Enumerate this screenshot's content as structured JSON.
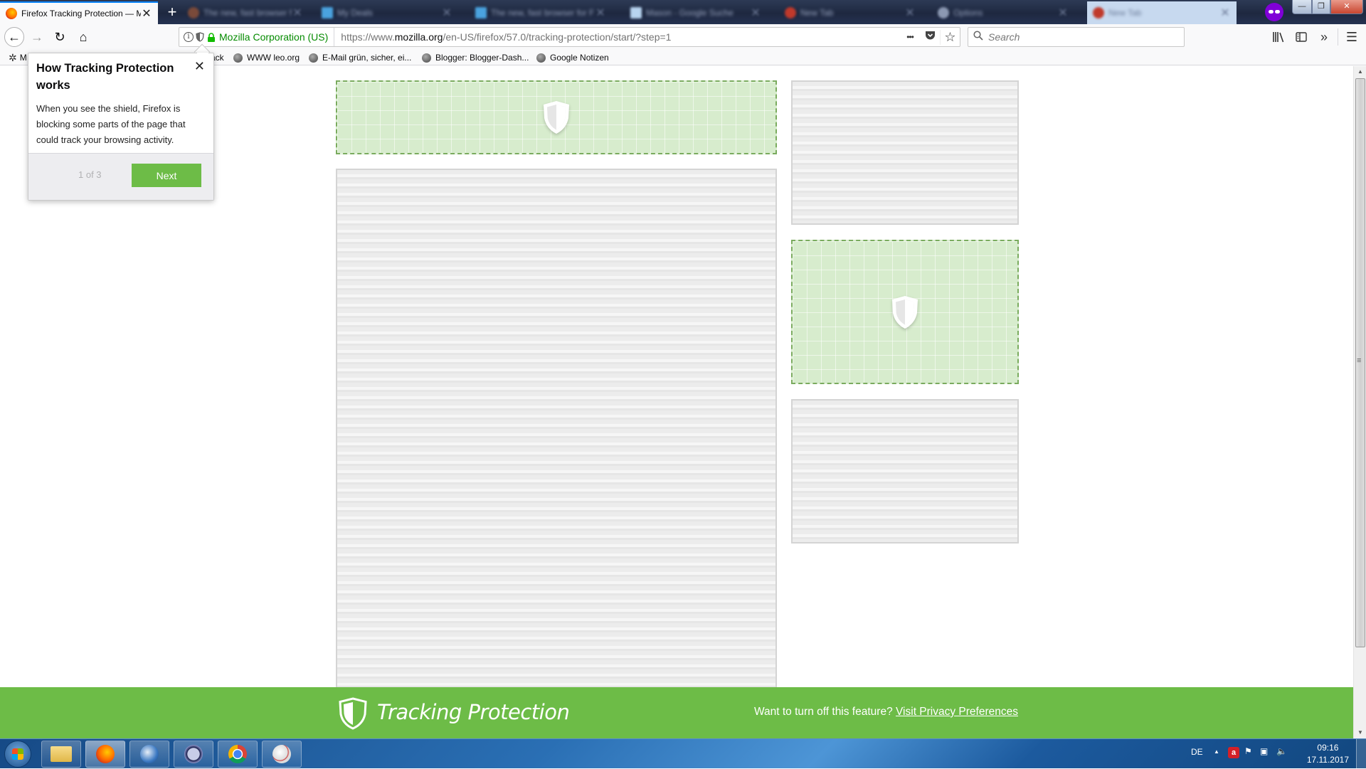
{
  "browser": {
    "active_tab": {
      "title": "Firefox Tracking Protection — Mozilla",
      "close": "✕"
    },
    "background_tabs": [
      {
        "title": "The new, fast browser for Fi...",
        "close": "✕",
        "favicon_color": "#7a4a3a"
      },
      {
        "title": "My Deals",
        "close": "✕",
        "favicon_color": "#4aa3df"
      },
      {
        "title": "The new, fast browser for Fi...",
        "close": "✕",
        "favicon_color": "#4aa3df"
      },
      {
        "title": "Mason - Google Suche",
        "close": "✕",
        "favicon_color": "#b8d4f0"
      },
      {
        "title": "New Tab",
        "close": "✕",
        "favicon_color": "#c0392b"
      },
      {
        "title": "Options",
        "close": "✕",
        "favicon_color": "#8c99b3"
      },
      {
        "title": "New Tab",
        "close": "✕",
        "favicon_color": "#c0392b"
      }
    ],
    "new_tab": "+",
    "window_controls": {
      "minimize": "—",
      "maximize": "❐",
      "close": "✕"
    }
  },
  "toolbar": {
    "back": "←",
    "forward": "→",
    "reload": "↻",
    "home": "⌂",
    "identity_info": "i",
    "identity_org": "Mozilla Corporation (US)",
    "url_prefix": "https://www.",
    "url_domain": "mozilla.org",
    "url_path": "/en-US/firefox/57.0/tracking-protection/start/?step=1",
    "page_actions": "•••",
    "pocket": "⛉",
    "bookmark_star": "☆",
    "search_placeholder": "Search",
    "library": "|||\\",
    "sidebar": "◫",
    "overflow": "»",
    "menu": "☰"
  },
  "bookmarks": [
    {
      "label": "M",
      "icon": "gear"
    },
    {
      "label": "ack",
      "icon": "none"
    },
    {
      "label": "WWW leo.org",
      "icon": "globe"
    },
    {
      "label": "E-Mail grün, sicher, ei...",
      "icon": "globe"
    },
    {
      "label": "Blogger: Blogger-Dash...",
      "icon": "globe"
    },
    {
      "label": "Google Notizen",
      "icon": "globe"
    }
  ],
  "popup": {
    "title": "How Tracking Protection works",
    "close": "✕",
    "body": "When you see the shield, Firefox is blocking some parts of the page that could track your browsing activity.",
    "step": "1 of 3",
    "next_label": "Next"
  },
  "page": {
    "blocks": [
      {
        "kind": "blocked",
        "label": "blocked-tracker-banner"
      },
      {
        "kind": "placeholder",
        "label": "content-main"
      },
      {
        "kind": "placeholder",
        "label": "content-side-top"
      },
      {
        "kind": "blocked",
        "label": "blocked-tracker-side"
      },
      {
        "kind": "placeholder",
        "label": "content-side-bottom"
      }
    ],
    "footer": {
      "title": "Tracking Protection",
      "question": "Want to turn off this feature?",
      "link": "Visit Privacy Preferences"
    }
  },
  "colors": {
    "brand_green": "#6dbc47",
    "blocked_fill": "#d7eccd",
    "blocked_border": "#7aab5e",
    "private_purple": "#8000d7",
    "secure_green": "#058b00"
  },
  "taskbar": {
    "apps": [
      "file-explorer",
      "firefox",
      "thunderbird",
      "keepass",
      "chrome",
      "snipping-tool"
    ],
    "language": "DE",
    "tray_expand": "▲",
    "time": "09:16",
    "date": "17.11.2017"
  }
}
